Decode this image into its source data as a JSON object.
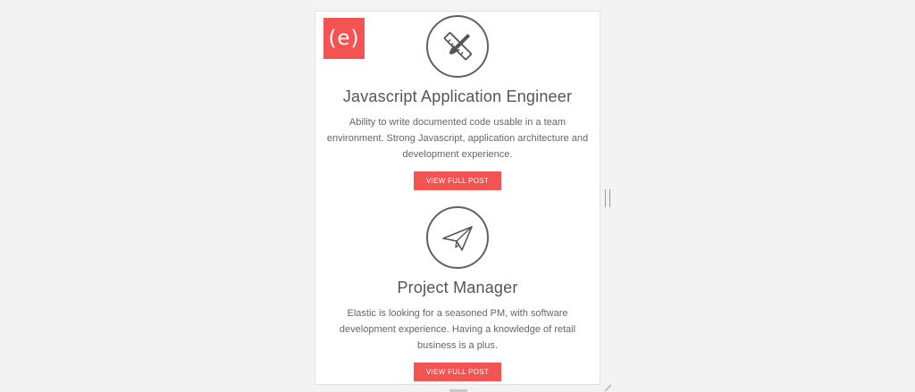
{
  "brand": {
    "logo_text": "(e)",
    "accent_color": "#f25453"
  },
  "jobs": [
    {
      "icon": "design-tools-icon",
      "title": "Javascript Application Engineer",
      "description": "Ability to write documented code usable in a team environment. Strong Javascript, application architecture and development experience.",
      "button_label": "VIEW FULL POST"
    },
    {
      "icon": "paper-plane-icon",
      "title": "Project Manager",
      "description": "Elastic is looking for a seasoned PM, with software development experience. Having a knowledge of retail business is a plus.",
      "button_label": "VIEW FULL POST"
    }
  ]
}
